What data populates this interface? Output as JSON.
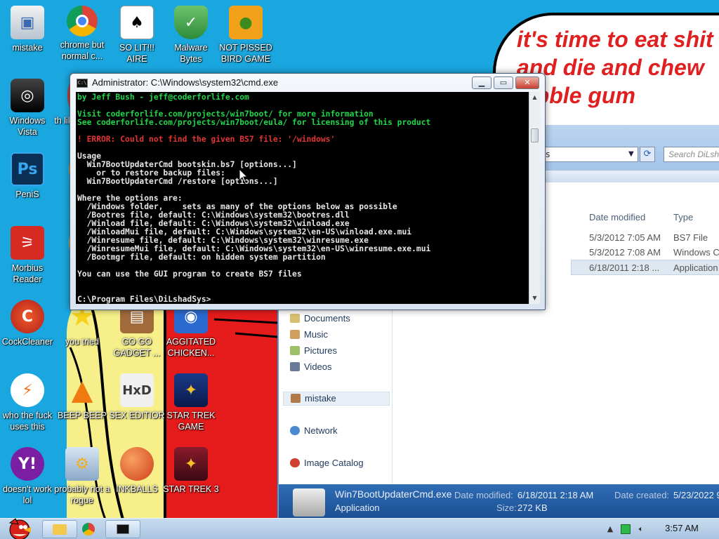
{
  "wallpaper": {
    "speech_text": "it's time to eat shit\nand die and chew\n   bble gum"
  },
  "desktop_icons": [
    {
      "label": "mistake"
    },
    {
      "label": "chrome but normal c..."
    },
    {
      "label": "SO LIT!!! AIRE"
    },
    {
      "label": "Malware Bytes"
    },
    {
      "label": "NOT PISSED BIRD GAME"
    },
    {
      "label": "Windows Vista"
    },
    {
      "label": "th like"
    },
    {
      "label": "PeniS"
    },
    {
      "label": "fu"
    },
    {
      "label": "Morbius Reader"
    },
    {
      "label": "c"
    },
    {
      "label": "CockCleaner"
    },
    {
      "label": "you tried"
    },
    {
      "label": "GO GO GADGET ..."
    },
    {
      "label": "AGGITATED CHICKEN..."
    },
    {
      "label": "who the fuck uses this"
    },
    {
      "label": "BEEP BEEP"
    },
    {
      "label": "SEX EDITIOR"
    },
    {
      "label": "STAR TREK GAME"
    },
    {
      "label": "doesn't work lol"
    },
    {
      "label": "probably not a rogue"
    },
    {
      "label": "INKBALLS"
    },
    {
      "label": "STAR TREK 3"
    }
  ],
  "explorer": {
    "address_text": "ys",
    "search_placeholder": "Search DiLsh",
    "columns": {
      "date_modified": "Date modified",
      "type": "Type"
    },
    "rows": [
      {
        "date": "5/3/2012 7:05 AM",
        "type": "BS7 File"
      },
      {
        "date": "5/3/2012 7:08 AM",
        "type": "Windows C"
      },
      {
        "date": "6/18/2011 2:18 ...",
        "type": "Application"
      }
    ],
    "nav_items": [
      "Documents",
      "Music",
      "Pictures",
      "Videos",
      "mistake",
      "Network",
      "Image Catalog"
    ],
    "details": {
      "filename": "Win7BootUpdaterCmd.exe",
      "filetype": "Application",
      "modified_key": "Date modified:",
      "modified_val": "6/18/2011 2:18 AM",
      "created_key": "Date created:",
      "created_val": "5/23/2022 9",
      "size_key": "Size:",
      "size_val": "272 KB"
    }
  },
  "cmd": {
    "title": "Administrator: C:\\Windows\\system32\\cmd.exe",
    "lines": [
      {
        "text": "by Jeff Bush - jeff@coderforlife.com",
        "color": "green"
      },
      {
        "text": "",
        "color": "white"
      },
      {
        "text": "Visit coderforlife.com/projects/win7boot/ for more information",
        "color": "green"
      },
      {
        "text": "See coderforlife.com/projects/win7boot/eula/ for licensing of this product",
        "color": "green"
      },
      {
        "text": "",
        "color": "white"
      },
      {
        "text": "! ERROR: Could not find the given BS7 file: '/windows'",
        "color": "red"
      },
      {
        "text": "",
        "color": "white"
      },
      {
        "text": "Usage",
        "color": "white"
      },
      {
        "text": "  Win7BootUpdaterCmd bootskin.bs7 [options...]",
        "color": "white"
      },
      {
        "text": "    or to restore backup files:",
        "color": "white"
      },
      {
        "text": "  Win7BootUpdaterCmd /restore [options...]",
        "color": "white"
      },
      {
        "text": "",
        "color": "white"
      },
      {
        "text": "Where the options are:",
        "color": "white"
      },
      {
        "text": "  /Windows folder,    sets as many of the options below as possible",
        "color": "white"
      },
      {
        "text": "  /Bootres file, default: C:\\Windows\\system32\\bootres.dll",
        "color": "white"
      },
      {
        "text": "  /Winload file, default: C:\\Windows\\system32\\winload.exe",
        "color": "white"
      },
      {
        "text": "  /WinloadMui file, default: C:\\Windows\\system32\\en-US\\winload.exe.mui",
        "color": "white"
      },
      {
        "text": "  /Winresume file, default: C:\\Windows\\system32\\winresume.exe",
        "color": "white"
      },
      {
        "text": "  /WinresumeMui file, default: C:\\Windows\\system32\\en-US\\winresume.exe.mui",
        "color": "white"
      },
      {
        "text": "  /Bootmgr file, default: on hidden system partition",
        "color": "white"
      },
      {
        "text": "",
        "color": "white"
      },
      {
        "text": "You can use the GUI program to create BS7 files",
        "color": "white"
      },
      {
        "text": "",
        "color": "white"
      },
      {
        "text": "",
        "color": "white"
      },
      {
        "text": "C:\\Program Files\\DiLshadSys>",
        "color": "white"
      }
    ],
    "buttons": {
      "minimize": "▁",
      "maximize": "▭",
      "close": "✕"
    }
  },
  "taskbar": {
    "clock": "3:57 AM"
  },
  "colors": {
    "desktop_bg": "#1aa7df",
    "console_green": "#21d64a",
    "console_red": "#e23434",
    "speech_red": "#e02020"
  }
}
